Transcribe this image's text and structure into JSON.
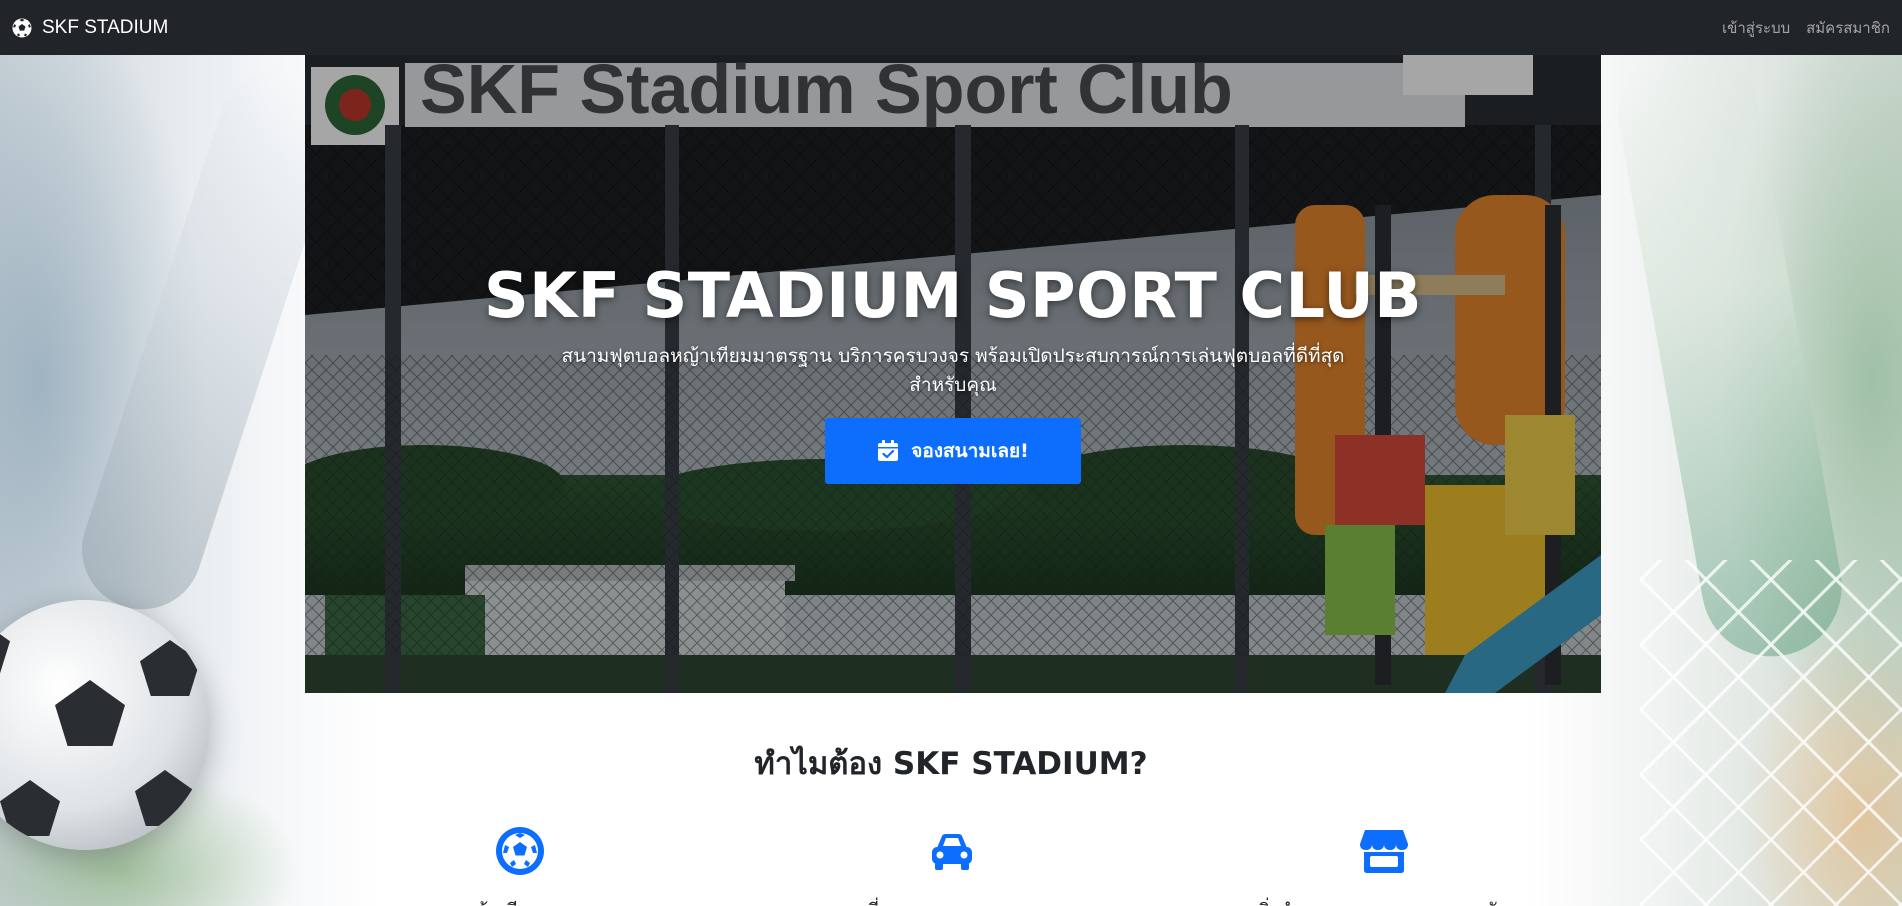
{
  "navbar": {
    "brand_text": "SKF STADIUM",
    "brand_icon": "soccer-ball-icon",
    "links": [
      {
        "label": "เข้าสู่ระบบ"
      },
      {
        "label": "สมัครสมาชิก"
      }
    ]
  },
  "hero": {
    "sign_text": "SKF Stadium Sport Club",
    "title": "SKF STADIUM SPORT CLUB",
    "subtitle": "สนามฟุตบอลหญ้าเทียมมาตรฐาน บริการครบวงจร พร้อมเปิดประสบการณ์การเล่นฟุตบอลที่ดีที่สุดสำหรับคุณ",
    "cta_label": "จองสนามเลย!",
    "cta_icon": "calendar-check-icon"
  },
  "why": {
    "title": "ทำไมต้อง SKF STADIUM?",
    "features": [
      {
        "icon": "soccer-ball-icon",
        "label": "สนามหญ้าเทียมคุณภาพสูง"
      },
      {
        "icon": "car-icon",
        "label": "ที่จอดรถสะดวกสบาย"
      },
      {
        "icon": "shop-icon",
        "label": "สิ่งอำนวยความสะดวกครบครัน"
      }
    ]
  },
  "colors": {
    "navbar_bg": "#212529",
    "primary": "#0d6efd",
    "text_dark": "#212529"
  }
}
